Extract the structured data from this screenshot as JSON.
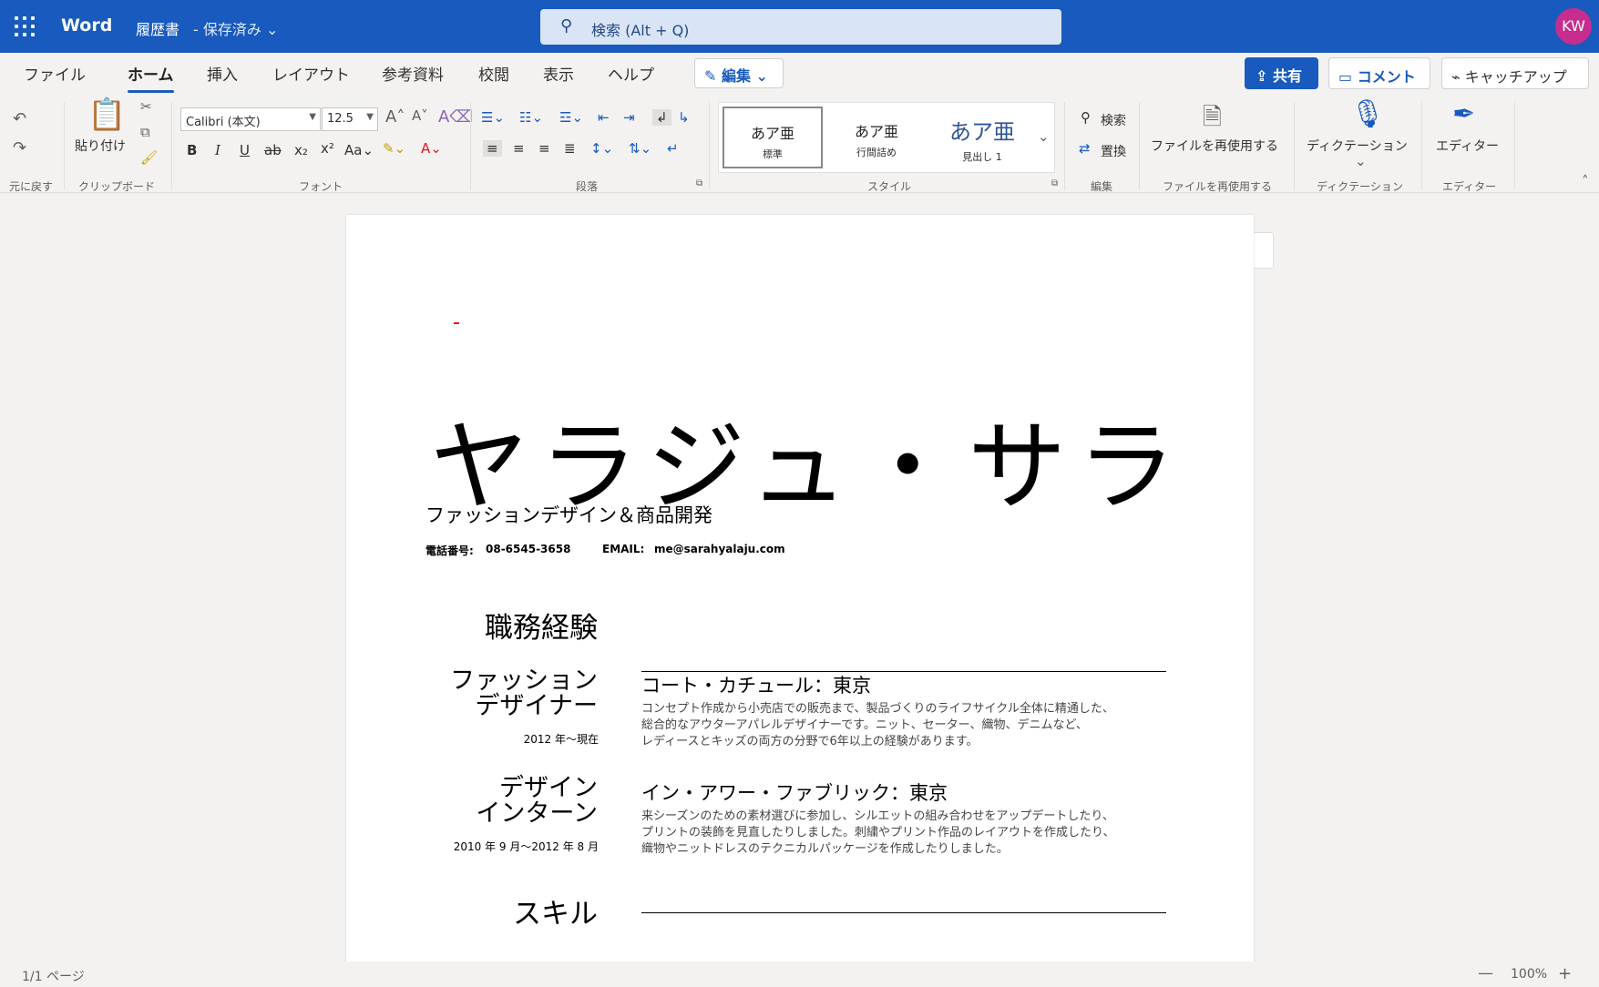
{
  "titlebar": {
    "app": "Word",
    "document": "履歴書",
    "status": "- 保存済み ⌄",
    "search_placeholder": "検索 (Alt + Q)",
    "avatar": "KW"
  },
  "tabs": [
    "ファイル",
    "ホーム",
    "挿入",
    "レイアウト",
    "参考資料",
    "校閲",
    "表示",
    "ヘルプ"
  ],
  "active_tab": "ホーム",
  "actions": {
    "edit": "✎ 編集 ⌄",
    "share": "⇪ 共有",
    "comment": "▭ コメント",
    "catchup": "⌁ キャッチアップ"
  },
  "ribbon": {
    "undo_group": "元に戻す",
    "clipboard_group": "クリップボード",
    "paste": "貼り付け",
    "font_group": "フォント",
    "font_name": "Calibri (本文)",
    "font_size": "12.5",
    "paragraph_group": "段落",
    "styles_group": "スタイル",
    "styles": [
      {
        "sample": "あア亜",
        "name": "標準"
      },
      {
        "sample": "あア亜",
        "name": "行間詰め"
      },
      {
        "sample": "あア亜",
        "name": "見出し 1"
      }
    ],
    "editing_group": "編集",
    "find": "検索",
    "replace": "置換",
    "reuse": "ファイルを再使用する",
    "reuse_group": "ファイルを再使用する",
    "dictation": "ディクテーション",
    "dictation_group": "ディクテーション",
    "editor": "エディター",
    "editor_group": "エディター"
  },
  "document": {
    "name": "ヤラジュ・サラ",
    "subtitle": "ファッションデザイン＆商品開発",
    "phone_label": "電話番号:",
    "phone": "08-6545-3658",
    "email_label": "EMAIL:",
    "email": "me@sarahyalaju.com",
    "experience_heading": "職務経験",
    "jobs": [
      {
        "role_line1": "ファッション",
        "role_line2": "デザイナー",
        "dates": "2012 年～現在",
        "employer": "コート・カチュール：東京",
        "desc_lines": [
          "コンセプト作成から小売店での販売まで、製品づくりのライフサイクル全体に精通した、",
          "総合的なアウターアパレルデザイナーです。ニット、セーター、織物、デニムなど、",
          "レディースとキッズの両方の分野で6年以上の経験があります。"
        ]
      },
      {
        "role_line1": "デザイン",
        "role_line2": "インターン",
        "dates": "2010 年 9 月～2012 年 8 月",
        "employer": "イン・アワー・ファブリック：東京",
        "desc_lines": [
          "来シーズンのための素材選びに参加し、シルエットの組み合わせをアップデートしたり、",
          "プリントの装飾を見直したりしました。刺繍やプリント作品のレイアウトを作成したり、",
          "織物やニットドレスのテクニカルパッケージを作成したりしました。"
        ]
      }
    ],
    "skills_heading": "スキル"
  },
  "statusbar": {
    "page": "1/1 ページ",
    "zoom_minus": "—",
    "zoom": "100%",
    "zoom_plus": "+"
  }
}
